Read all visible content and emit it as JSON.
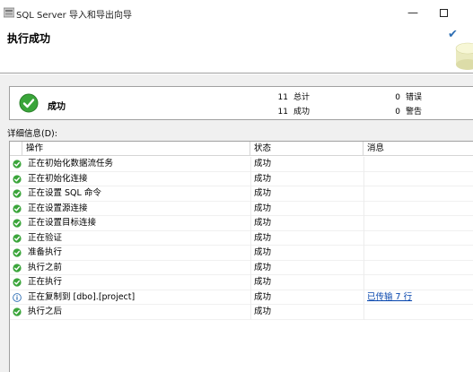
{
  "window": {
    "title": "SQL Server 导入和导出向导",
    "minimize_glyph": "—"
  },
  "header": {
    "title": "执行成功",
    "check_glyph": "✔"
  },
  "summary": {
    "status_label": "成功",
    "status_icon": "success-check-icon",
    "total_count": "11",
    "total_label": "总计",
    "success_count": "11",
    "success_label": "成功",
    "error_count": "0",
    "error_label": "错误",
    "warning_count": "0",
    "warning_label": "警告"
  },
  "details": {
    "label": "详细信息(D):",
    "columns": {
      "action": "操作",
      "status": "状态",
      "message": "消息"
    },
    "rows": [
      {
        "icon": "success",
        "action": "正在初始化数据流任务",
        "status": "成功",
        "message": ""
      },
      {
        "icon": "success",
        "action": "正在初始化连接",
        "status": "成功",
        "message": ""
      },
      {
        "icon": "success",
        "action": "正在设置 SQL 命令",
        "status": "成功",
        "message": ""
      },
      {
        "icon": "success",
        "action": "正在设置源连接",
        "status": "成功",
        "message": ""
      },
      {
        "icon": "success",
        "action": "正在设置目标连接",
        "status": "成功",
        "message": ""
      },
      {
        "icon": "success",
        "action": "正在验证",
        "status": "成功",
        "message": ""
      },
      {
        "icon": "success",
        "action": "准备执行",
        "status": "成功",
        "message": ""
      },
      {
        "icon": "success",
        "action": "执行之前",
        "status": "成功",
        "message": ""
      },
      {
        "icon": "success",
        "action": "正在执行",
        "status": "成功",
        "message": ""
      },
      {
        "icon": "info",
        "action": "正在复制到 [dbo].[project]",
        "status": "成功",
        "message": "已传输 7 行"
      },
      {
        "icon": "success",
        "action": "执行之后",
        "status": "成功",
        "message": ""
      }
    ]
  },
  "colors": {
    "success_green": "#3aa53a",
    "info_blue": "#2f6fb4",
    "link_blue": "#0645ad"
  }
}
